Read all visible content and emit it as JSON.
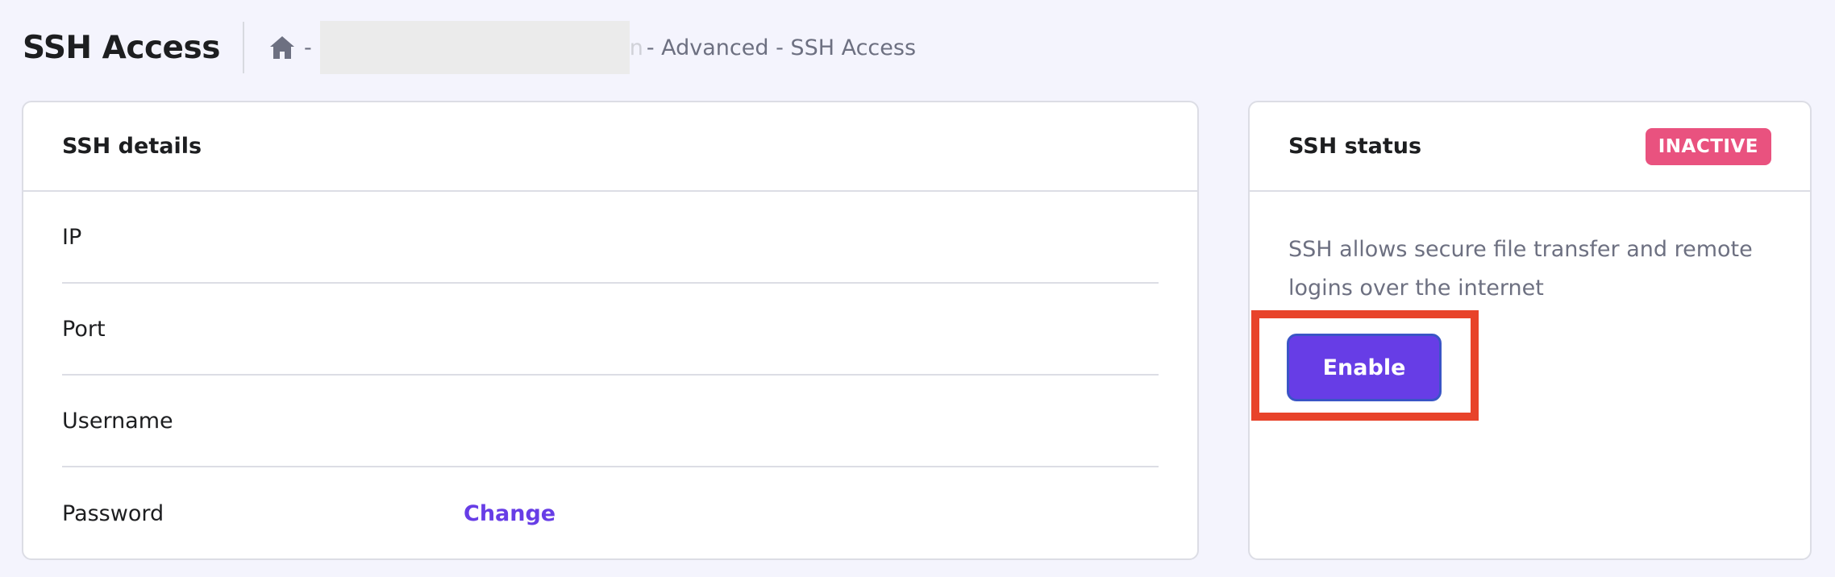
{
  "header": {
    "page_title": "SSH Access",
    "breadcrumb": {
      "home_icon": "home-icon",
      "separator": "-",
      "visible_fragment": "n",
      "tail": "- Advanced - SSH Access"
    }
  },
  "details_card": {
    "title": "SSH details",
    "rows": [
      {
        "label": "IP",
        "value": ""
      },
      {
        "label": "Port",
        "value": ""
      },
      {
        "label": "Username",
        "value": ""
      },
      {
        "label": "Password",
        "value": "",
        "action_label": "Change"
      }
    ]
  },
  "status_card": {
    "title": "SSH status",
    "status": "INACTIVE",
    "description": "SSH allows secure file transfer and remote logins over the internet",
    "enable_label": "Enable"
  },
  "colors": {
    "background": "#f4f4fd",
    "accent": "#673de6",
    "inactive_badge": "#e9527f",
    "highlight": "#e8432a"
  }
}
